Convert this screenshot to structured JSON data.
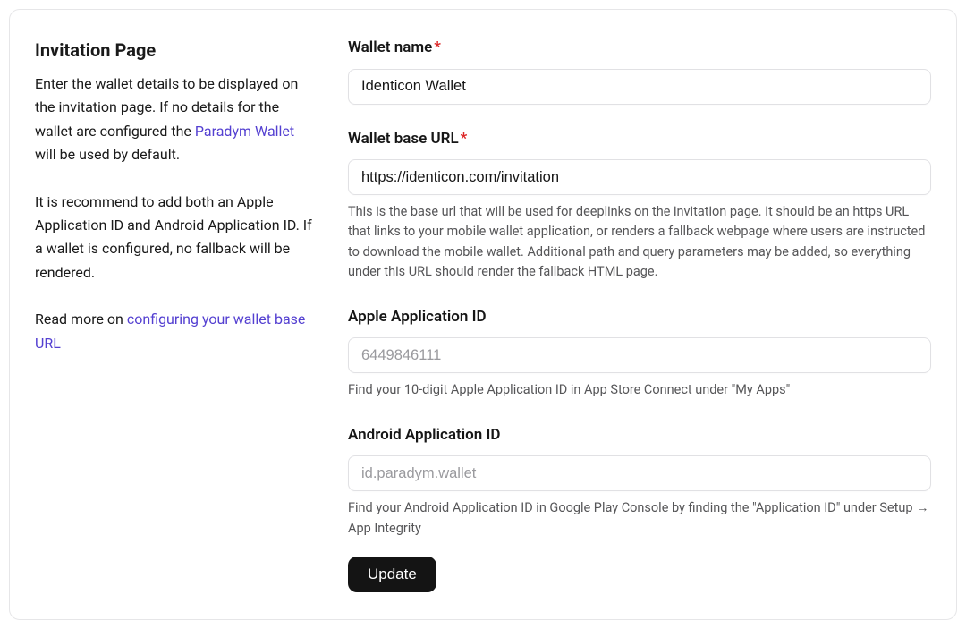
{
  "left": {
    "heading": "Invitation Page",
    "p1_a": "Enter the wallet details to be displayed on the invitation page. If no details for the wallet are configured the ",
    "p1_link": "Paradym Wallet",
    "p1_b": " will be used by default.",
    "p2": "It is recommend to add both an Apple Application ID and Android Application ID. If a wallet is configured, no fallback will be rendered.",
    "p3_a": "Read more on ",
    "p3_link": "configuring your wallet base URL"
  },
  "form": {
    "wallet_name": {
      "label": "Wallet name",
      "value": "Identicon Wallet"
    },
    "wallet_base_url": {
      "label": "Wallet base URL",
      "value": "https://identicon.com/invitation",
      "help": "This is the base url that will be used for deeplinks on the invitation page. It should be an https URL that links to your mobile wallet application, or renders a fallback webpage where users are instructed to download the mobile wallet. Additional path and query parameters may be added, so everything under this URL should render the fallback HTML page."
    },
    "apple_app_id": {
      "label": "Apple Application ID",
      "placeholder": "6449846111",
      "value": "",
      "help": "Find your 10-digit Apple Application ID in App Store Connect under \"My Apps\""
    },
    "android_app_id": {
      "label": "Android Application ID",
      "placeholder": "id.paradym.wallet",
      "value": "",
      "help": "Find your Android Application ID in Google Play Console by finding the \"Application ID\" under Setup → App Integrity"
    },
    "submit_label": "Update"
  },
  "required_mark": "*"
}
